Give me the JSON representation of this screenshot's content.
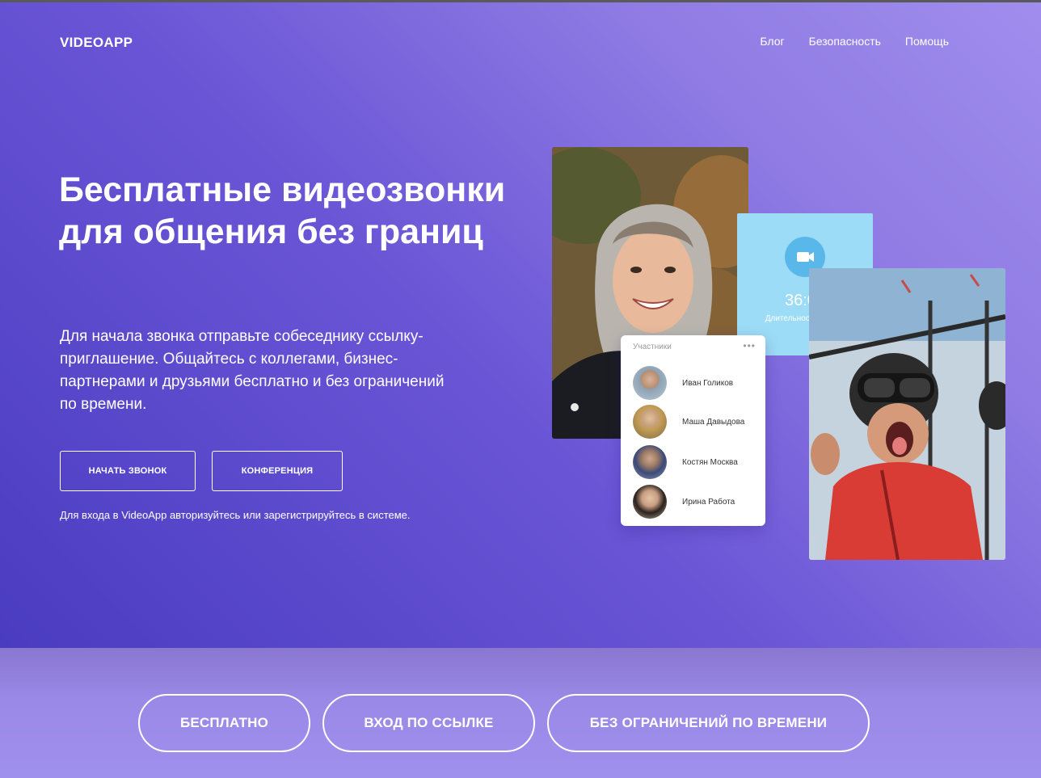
{
  "header": {
    "logo": "VIDEOAPP",
    "nav": [
      "Блог",
      "Безопасность",
      "Помощь"
    ]
  },
  "hero": {
    "headline": "Бесплатные видеозвонки для общения без границ",
    "description": "Для начала звонка отправьте собеседнику ссылку-приглашение. Общайтесь с коллегами, бизнес-партнерами и друзьями бесплатно и без ограничений по времени.",
    "buttons": {
      "start_call": "НАЧАТЬ ЗВОНОК",
      "conference": "КОНФЕРЕНЦИЯ"
    },
    "note": "Для входа в VideoApp авторизуйтесь или зарегистрируйтесь в системе."
  },
  "call_widget": {
    "duration": "36:05",
    "duration_label": "Длительность звонка",
    "icon": "video-camera-icon"
  },
  "participants": {
    "title": "Участники",
    "list": [
      {
        "name": "Иван Голиков"
      },
      {
        "name": "Маша Давыдова"
      },
      {
        "name": "Костян Москва"
      },
      {
        "name": "Ирина Работа"
      }
    ]
  },
  "features": [
    "БЕСПЛАТНО",
    "ВХОД ПО ССЫЛКЕ",
    "БЕЗ ОГРАНИЧЕНИЙ ПО ВРЕМЕНИ"
  ],
  "colors": {
    "accent": "#6a55d6",
    "timer_card": "#9ddcf6",
    "camera_circle": "#5ab7ea"
  }
}
